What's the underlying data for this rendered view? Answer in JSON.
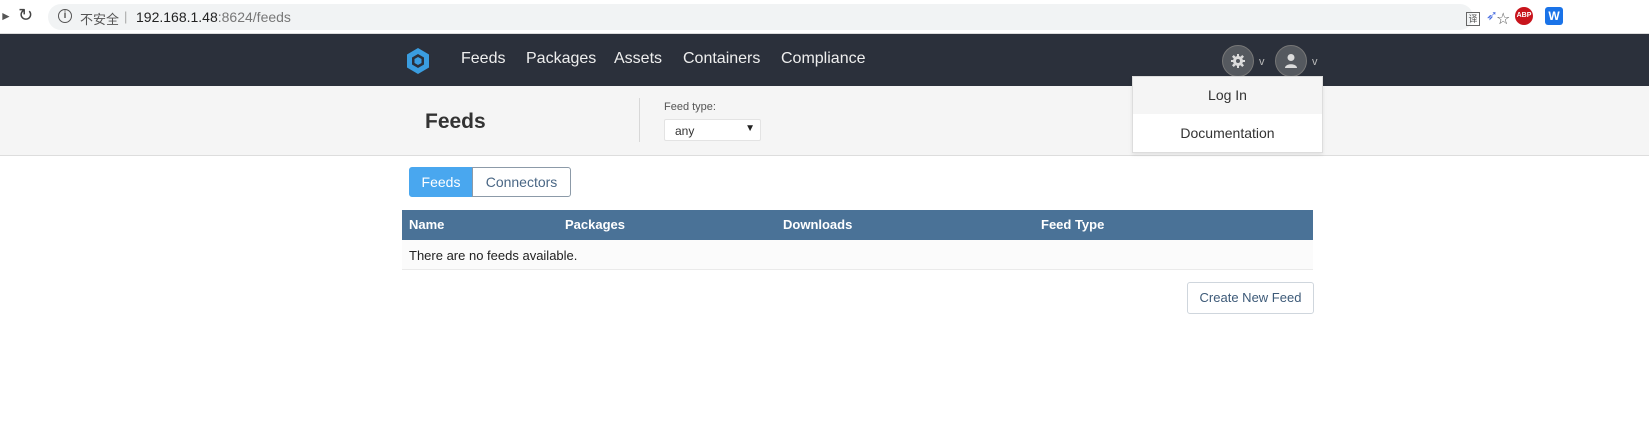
{
  "browser": {
    "security_label": "不安全",
    "separator": "|",
    "url_host": "192.168.1.48",
    "url_rest": ":8624/feeds",
    "abp_label": "ABP",
    "w_label": "W"
  },
  "nav": {
    "items": [
      "Feeds",
      "Packages",
      "Assets",
      "Containers",
      "Compliance"
    ],
    "caret": "v"
  },
  "dropdown": {
    "items": [
      "Log In",
      "Documentation"
    ]
  },
  "subheader": {
    "title": "Feeds",
    "filter_label": "Feed type:",
    "filter_value": "any"
  },
  "tabs": [
    {
      "label": "Feeds",
      "active": true
    },
    {
      "label": "Connectors",
      "active": false
    }
  ],
  "table": {
    "columns": [
      "Name",
      "Packages",
      "Downloads",
      "Feed Type"
    ],
    "empty_message": "There are no feeds available."
  },
  "actions": {
    "create_label": "Create New Feed"
  },
  "colors": {
    "navbar": "#2b303b",
    "accent": "#49a7ef",
    "table_header": "#4a7297"
  }
}
